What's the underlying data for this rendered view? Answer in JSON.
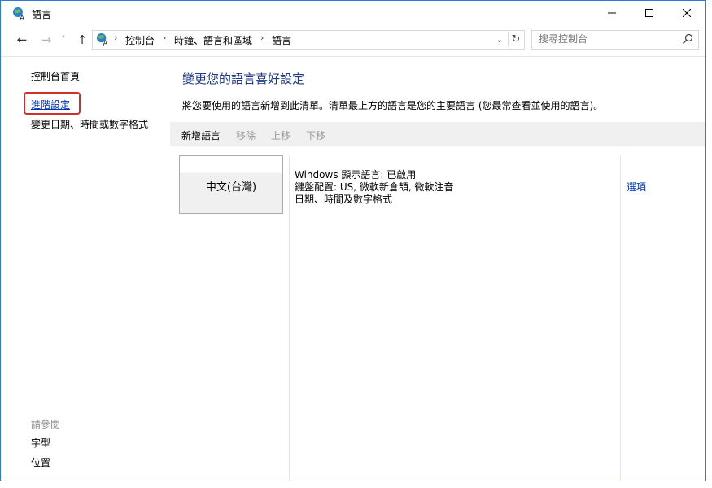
{
  "window": {
    "title": "語言"
  },
  "nav": {
    "breadcrumbs": [
      "控制台",
      "時鐘、語言和區域",
      "語言"
    ],
    "search_placeholder": "搜尋控制台"
  },
  "left_pane": {
    "home": "控制台首頁",
    "advanced": "進階設定",
    "date_time": "變更日期、時間或數字格式",
    "see_also": "請參閱",
    "fonts": "字型",
    "location": "位置"
  },
  "main": {
    "heading": "變更您的語言喜好設定",
    "description": "將您要使用的語言新增到此清單。清單最上方的語言是您的主要語言 (您最常查看並使用的語言)。",
    "toolbar": {
      "add": "新增語言",
      "remove": "移除",
      "move_up": "上移",
      "move_down": "下移"
    },
    "language": {
      "name": "中文(台灣)",
      "info": [
        "Windows 顯示語言: 已啟用",
        "鍵盤配置: US, 微軟新倉頡, 微軟注音",
        "日期、時間及數字格式"
      ],
      "options": "選項"
    }
  },
  "colors": {
    "accent": "#2b7bd6",
    "link": "#0033bb",
    "heading": "#1e3a8a",
    "highlight_box": "#d42b2b"
  }
}
